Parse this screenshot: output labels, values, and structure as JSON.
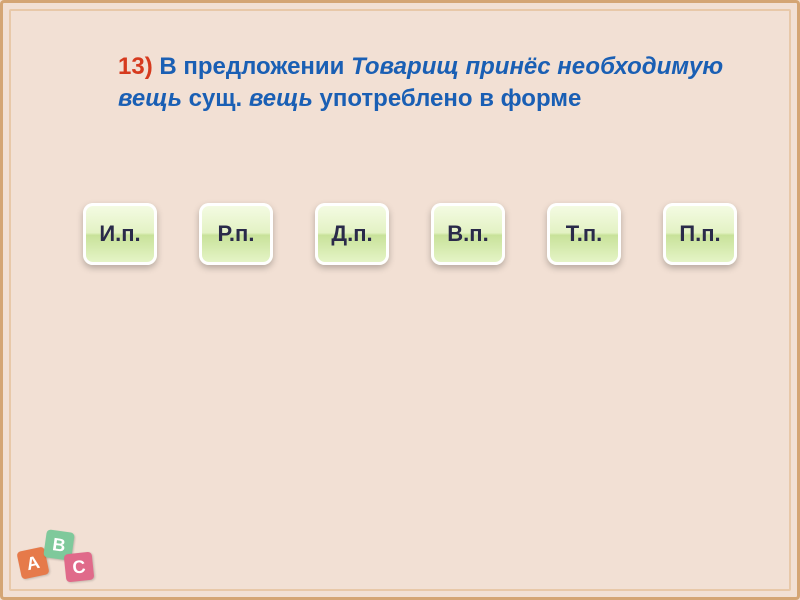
{
  "question": {
    "number": "13)",
    "part1": "В предложении",
    "sentence": "Товарищ принёс необходимую вещь",
    "part2": "сущ.",
    "noun": "вещь",
    "part3": "употреблено в форме"
  },
  "options": [
    {
      "label": "И.п."
    },
    {
      "label": "Р.п."
    },
    {
      "label": "Д.п."
    },
    {
      "label": "В.п."
    },
    {
      "label": "Т.п."
    },
    {
      "label": "П.п."
    }
  ],
  "abc": {
    "a": "A",
    "b": "B",
    "c": "C"
  }
}
